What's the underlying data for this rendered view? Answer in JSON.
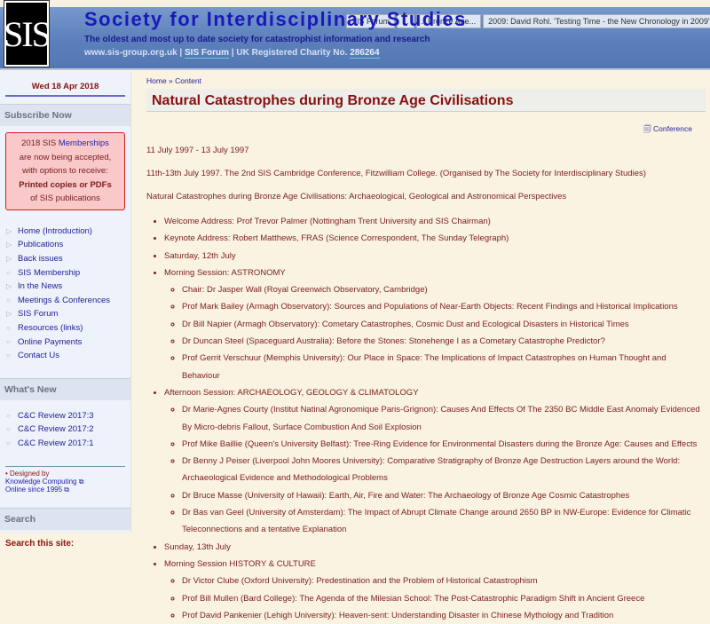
{
  "header": {
    "logo_text": "SIS",
    "title": "Society for Interdisciplinary Studies",
    "tagline": "The oldest and most up to date society for catastrophist information and research",
    "site": "www.sis-group.org.uk",
    "forum": "SIS Forum",
    "charity": "UK Registered Charity No.",
    "charity_no": "286264"
  },
  "browser_tabs": [
    "SIS Forum",
    "...",
    "...Bronze Age...",
    "2009: David Rohl. 'Testing Time - the New Chronology in 2009'"
  ],
  "sidebar": {
    "date": "Wed 18 Apr 2018",
    "subscribe_heading": "Subscribe Now",
    "subscribe": {
      "l1a": "2018 SIS ",
      "l1b": "Memberships",
      "l2": "are now being accepted,",
      "l3": "with options to receive:",
      "l4": "Printed copies or PDFs",
      "l5": "of SIS publications"
    },
    "nav": [
      "Home (Introduction)",
      "Publications",
      "Back issues",
      "SIS Membership",
      "In the News",
      "Meetings & Conferences",
      "SIS Forum",
      "Resources (links)",
      "Online Payments",
      "Contact Us"
    ],
    "whats_new_heading": "What's New",
    "whats_new": [
      "C&C Review 2017:3",
      "C&C Review 2017:2",
      "C&C Review 2017:1"
    ],
    "credit": {
      "designed": "• Designed by",
      "kc": "Knowledge Computing",
      "online": "Online since 1995"
    },
    "search_heading": "Search",
    "search_label": "Search this site:"
  },
  "main": {
    "breadcrumb_home": "Home",
    "breadcrumb_sep": " » ",
    "breadcrumb_content": "Content",
    "title": "Natural Catastrophes during Bronze Age Civilisations",
    "conference_link": "Conference",
    "dates": "11 July 1997 - 13 July 1997",
    "intro": "11th-13th July 1997. The 2nd SIS Cambridge Conference, Fitzwilliam College. (Organised by The Society for Interdisciplinary Studies)",
    "subtitle": "Natural Catastrophes during Bronze Age Civilisations: Archaeological, Geological and Astronomical Perspectives",
    "program": [
      {
        "text": "Welcome Address: Prof Trevor Palmer (Nottingham Trent University and SIS Chairman)",
        "items": []
      },
      {
        "text": "Keynote Address: Robert Matthews, FRAS (Science Correspondent, The Sunday Telegraph)",
        "items": []
      },
      {
        "text": "Saturday, 12th July",
        "items": []
      },
      {
        "text": "Morning Session: ASTRONOMY",
        "items": [
          "Chair: Dr Jasper Wall (Royal Greenwich Observatory, Cambridge)",
          "Prof Mark Bailey (Armagh Observatory): Sources and Populations of Near-Earth Objects: Recent Findings and Historical Implications",
          "Dr Bill Napier (Armagh Observatory): Cometary Catastrophes, Cosmic Dust and Ecological Disasters in Historical Times",
          "Dr Duncan Steel (Spaceguard Australia): Before the Stones: Stonehenge I as a Cometary Catastrophe Predictor?",
          "Prof Gerrit Verschuur (Memphis University): Our Place in Space: The Implications of Impact Catastrophes on Human Thought and Behaviour"
        ]
      },
      {
        "text": "Afternoon Session: ARCHAEOLOGY, GEOLOGY & CLIMATOLOGY",
        "items": [
          "Dr Marie-Agnes Courty (Institut Natinal Agronomique Paris-Grignon): Causes And Effects Of The 2350 BC Middle East Anomaly Evidenced By Micro-debris Fallout, Surface Combustion And Soil Explosion",
          "Prof Mike Baillie (Queen's University Belfast): Tree-Ring Evidence for Environmental Disasters during the Bronze Age: Causes and Effects",
          "Dr Benny J Peiser (Liverpool John Moores University): Comparative Stratigraphy of Bronze Age Destruction Layers around the World: Archaeological Evidence and Methodological Problems",
          "Dr Bruce Masse (University of Hawaii): Earth, Air, Fire and Water: The Archaeology of Bronze Age Cosmic Catastrophes",
          "Dr Bas van Geel (University of Amsterdam): The Impact of Abrupt Climate Change around 2650 BP in NW-Europe: Evidence for Climatic Teleconnections and a tentative Explanation"
        ]
      },
      {
        "text": "Sunday, 13th July",
        "items": []
      },
      {
        "text": "Morning Session HISTORY & CULTURE",
        "items": [
          "Dr Victor Clube (Oxford University): Predestination and the Problem of Historical Catastrophism",
          "Prof Bill Mullen (Bard College): The Agenda of the Milesian School: The Post-Catastrophic Paradigm Shift in Ancient Greece",
          "Prof David Pankenier (Lehigh University): Heaven-sent: Understanding Disaster in Chinese Mythology and Tradition"
        ]
      }
    ]
  }
}
